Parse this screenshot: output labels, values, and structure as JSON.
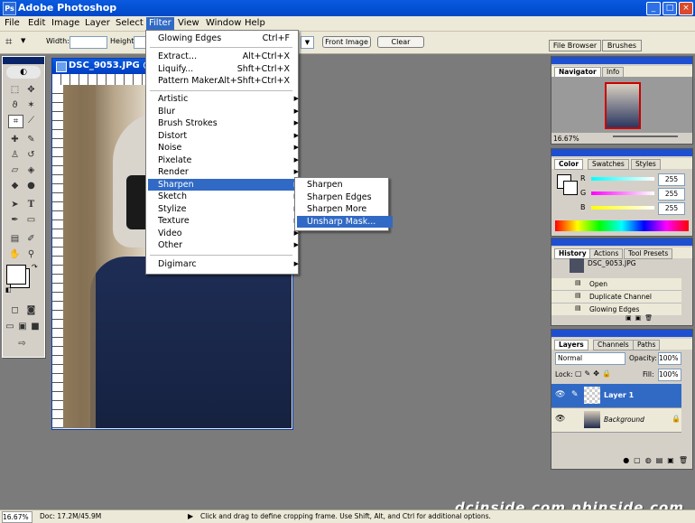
{
  "window": {
    "title": "Adobe Photoshop",
    "app_icon": "Ps"
  },
  "menubar": [
    "File",
    "Edit",
    "Image",
    "Layer",
    "Select",
    "Filter",
    "View",
    "Window",
    "Help"
  ],
  "options": {
    "width_label": "Width:",
    "height_label": "Height:",
    "front_image": "Front Image",
    "clear": "Clear",
    "file_browser": "File Browser",
    "brushes": "Brushes"
  },
  "document": {
    "title": "DSC_9053.JPG @"
  },
  "filter_menu": {
    "last": {
      "label": "Glowing Edges",
      "shortcut": "Ctrl+F"
    },
    "group1": [
      {
        "label": "Extract...",
        "shortcut": "Alt+Ctrl+X"
      },
      {
        "label": "Liquify...",
        "shortcut": "Shft+Ctrl+X"
      },
      {
        "label": "Pattern Maker...",
        "shortcut": "Alt+Shft+Ctrl+X"
      }
    ],
    "group2": [
      "Artistic",
      "Blur",
      "Brush Strokes",
      "Distort",
      "Noise",
      "Pixelate",
      "Render",
      "Sharpen",
      "Sketch",
      "Stylize",
      "Texture",
      "Video",
      "Other"
    ],
    "group3": [
      "Digimarc"
    ]
  },
  "sharpen_menu": [
    "Sharpen",
    "Sharpen Edges",
    "Sharpen More",
    "Unsharp Mask..."
  ],
  "navigator": {
    "tabs": [
      "Navigator",
      "Info"
    ],
    "zoom": "16.67%"
  },
  "color": {
    "tabs": [
      "Color",
      "Swatches",
      "Styles"
    ],
    "r_label": "R",
    "g_label": "G",
    "b_label": "B",
    "r": "255",
    "g": "255",
    "b": "255"
  },
  "history": {
    "tabs": [
      "History",
      "Actions",
      "Tool Presets"
    ],
    "snapshot": "DSC_9053.JPG",
    "items": [
      "Open",
      "Duplicate Channel",
      "Glowing Edges"
    ]
  },
  "layers": {
    "tabs": [
      "Layers",
      "Channels",
      "Paths"
    ],
    "blend": "Normal",
    "opacity_label": "Opacity:",
    "opacity": "100%",
    "lock_label": "Lock:",
    "fill_label": "Fill:",
    "fill": "100%",
    "rows": [
      "Layer 1",
      "Background"
    ]
  },
  "status": {
    "zoom": "16.67%",
    "doc": "Doc: 17.2M/45.9M",
    "hint": "Click and drag to define cropping frame. Use Shift, Alt, and Ctrl for additional options."
  },
  "watermark": "dcinside.com pbinside.com",
  "colors": {
    "accent": "#316ac5",
    "titlebar": "#0a5ae0"
  }
}
